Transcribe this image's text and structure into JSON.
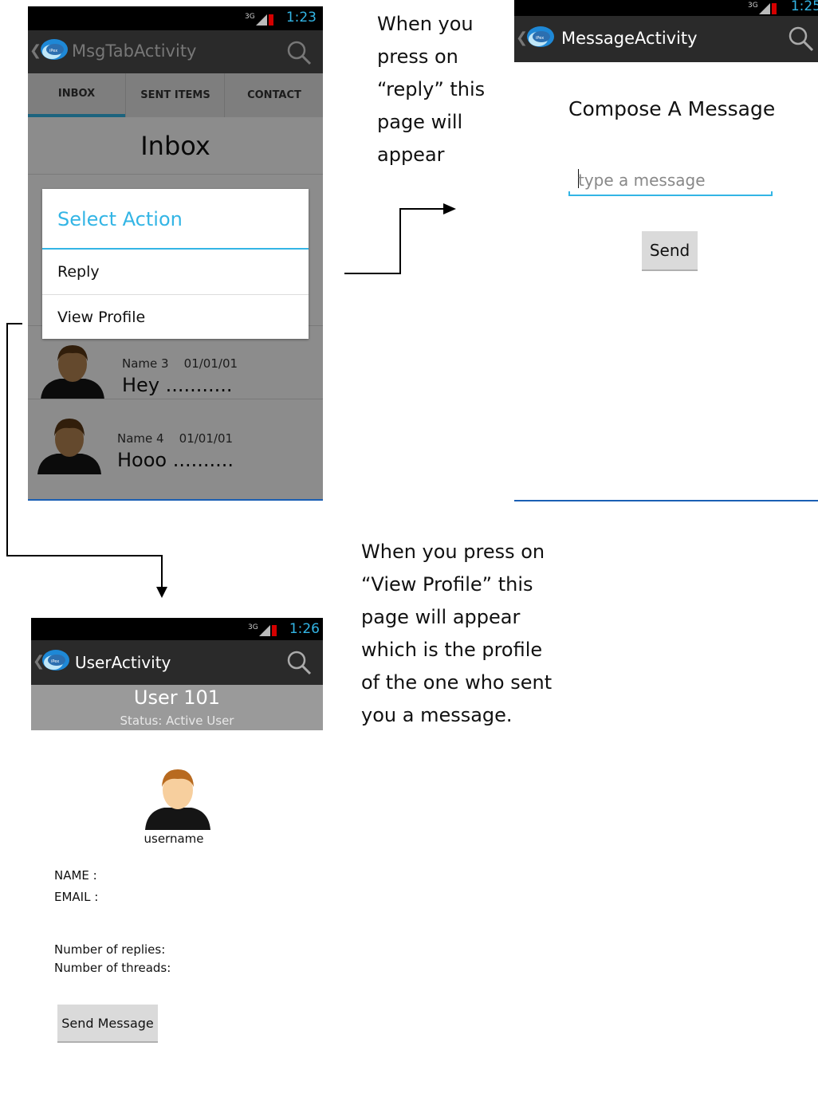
{
  "screen_inbox": {
    "status_time": "1:23",
    "network": "3G",
    "title": "MsgTabActivity",
    "tabs": [
      "INBOX",
      "SENT ITEMS",
      "CONTACT"
    ],
    "heading": "Inbox",
    "dialog": {
      "title": "Select Action",
      "items": [
        "Reply",
        "View Profile"
      ]
    },
    "messages": [
      {
        "name": "Name 3",
        "date": "01/01/01",
        "preview": "Hey ..........."
      },
      {
        "name": "Name 4",
        "date": "01/01/01",
        "preview": "Hooo .........."
      }
    ]
  },
  "screen_compose": {
    "status_time": "1:25",
    "title": "MessageActivity",
    "heading": "Compose A Message",
    "input_placeholder": "type a message",
    "send_label": "Send"
  },
  "screen_profile": {
    "status_time": "1:26",
    "network": "3G",
    "title": "UserActivity",
    "user_title": "User 101",
    "status": "Status: Active User",
    "username": "username",
    "name_label": "NAME :",
    "email_label": "EMAIL :",
    "replies_label": "Number of replies:",
    "threads_label": "Number of threads:",
    "send_message_label": "Send Message"
  },
  "annotations": {
    "reply_note": [
      "When you",
      "press on",
      "“reply” this",
      "page will",
      "appear"
    ],
    "profile_note": [
      "When you press on",
      "“View Profile” this",
      "page will appear",
      "which is the profile",
      "of the one who sent",
      "you a message."
    ]
  },
  "colors": {
    "accent": "#33b5e5",
    "actionbar": "#2a2a2a",
    "divider_blue": "#1a5fb4"
  }
}
